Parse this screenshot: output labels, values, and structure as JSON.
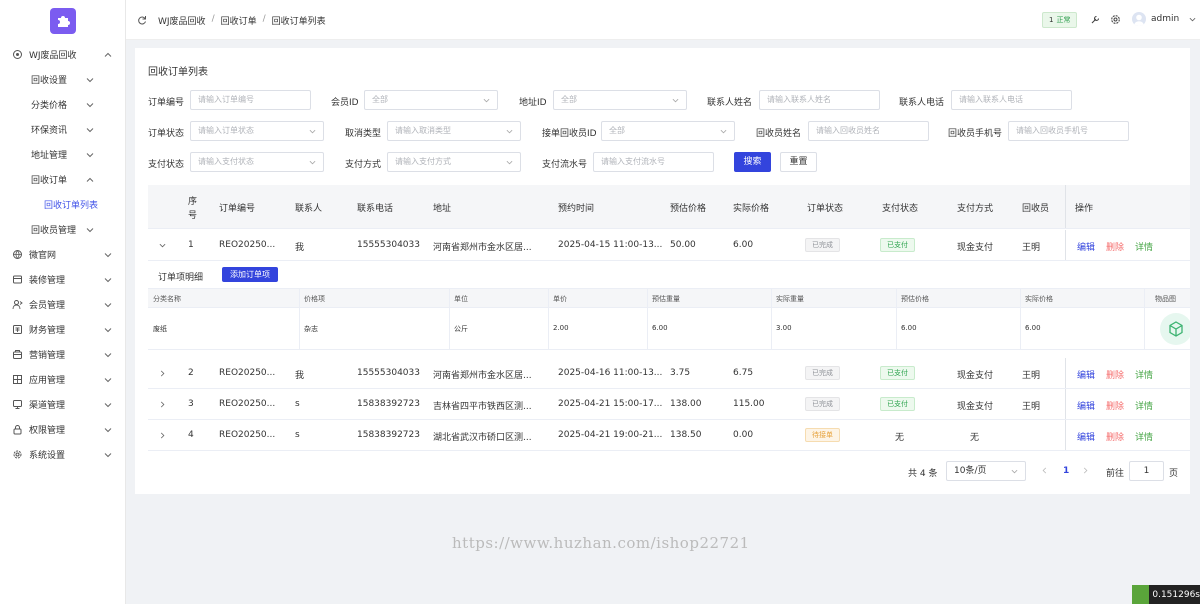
{
  "sidebar": {
    "items": [
      {
        "label": "WJ废品回收",
        "icon": "puzzle-icon",
        "arrow": "up"
      },
      {
        "label": "回收设置",
        "arrow": "down"
      },
      {
        "label": "分类价格",
        "arrow": "down"
      },
      {
        "label": "环保资讯",
        "arrow": "down"
      },
      {
        "label": "地址管理",
        "arrow": "down"
      },
      {
        "label": "回收订单",
        "arrow": "up"
      },
      {
        "label": "回收订单列表",
        "active": true
      },
      {
        "label": "回收员管理",
        "arrow": "down"
      },
      {
        "label": "微官网",
        "icon": "globe-icon",
        "arrow": "down"
      },
      {
        "label": "装修管理",
        "icon": "decoration-icon",
        "arrow": "down"
      },
      {
        "label": "会员管理",
        "icon": "user-icon",
        "arrow": "down"
      },
      {
        "label": "财务管理",
        "icon": "finance-icon",
        "arrow": "down"
      },
      {
        "label": "营销管理",
        "icon": "marketing-icon",
        "arrow": "down"
      },
      {
        "label": "应用管理",
        "icon": "app-icon",
        "arrow": "down"
      },
      {
        "label": "渠道管理",
        "icon": "channel-icon",
        "arrow": "down"
      },
      {
        "label": "权限管理",
        "icon": "lock-icon",
        "arrow": "down"
      },
      {
        "label": "系统设置",
        "icon": "gear-icon",
        "arrow": "down"
      }
    ]
  },
  "header": {
    "breadcrumb": [
      "WJ废品回收",
      "回收订单",
      "回收订单列表"
    ],
    "badge_count": "1",
    "badge_text": "正常",
    "username": "admin"
  },
  "card": {
    "title": "回收订单列表"
  },
  "filters": {
    "order_no": {
      "label": "订单编号",
      "placeholder": "请输入订单编号"
    },
    "member_id": {
      "label": "会员ID",
      "placeholder": "全部"
    },
    "address_id": {
      "label": "地址ID",
      "placeholder": "全部"
    },
    "contact_name": {
      "label": "联系人姓名",
      "placeholder": "请输入联系人姓名"
    },
    "contact_phone": {
      "label": "联系人电话",
      "placeholder": "请输入联系人电话"
    },
    "order_status": {
      "label": "订单状态",
      "placeholder": "请输入订单状态"
    },
    "cancel_type": {
      "label": "取消类型",
      "placeholder": "请输入取消类型"
    },
    "collector_id": {
      "label": "接单回收员ID",
      "placeholder": "全部"
    },
    "collector_name": {
      "label": "回收员姓名",
      "placeholder": "请输入回收员姓名"
    },
    "collector_phone": {
      "label": "回收员手机号",
      "placeholder": "请输入回收员手机号"
    },
    "pay_status": {
      "label": "支付状态",
      "placeholder": "请输入支付状态"
    },
    "pay_method": {
      "label": "支付方式",
      "placeholder": "请输入支付方式"
    },
    "pay_serial": {
      "label": "支付流水号",
      "placeholder": "请输入支付流水号"
    },
    "search_label": "搜索",
    "reset_label": "重置"
  },
  "table": {
    "headers": {
      "seq_1": "序",
      "seq_2": "号",
      "order_no": "订单编号",
      "contact": "联系人",
      "phone": "联系电话",
      "address": "地址",
      "appoint_time": "预约时间",
      "est_price": "预估价格",
      "real_price": "实际价格",
      "order_status": "订单状态",
      "pay_status": "支付状态",
      "pay_method": "支付方式",
      "collector": "回收员",
      "ops": "操作"
    },
    "rows": [
      {
        "seq": "1",
        "order_no": "REO20250...",
        "contact": "我",
        "phone": "15555304033",
        "address": "河南省郑州市金水区居...",
        "appoint_time": "2025-04-15 11:00-13...",
        "est_price": "50.00",
        "real_price": "6.00",
        "order_status": "已完成",
        "pay_status": "已支付",
        "pay_method": "现金支付",
        "collector": "王明"
      },
      {
        "seq": "2",
        "order_no": "REO20250...",
        "contact": "我",
        "phone": "15555304033",
        "address": "河南省郑州市金水区居...",
        "appoint_time": "2025-04-16 11:00-13...",
        "est_price": "3.75",
        "real_price": "6.75",
        "order_status": "已完成",
        "pay_status": "已支付",
        "pay_method": "现金支付",
        "collector": "王明"
      },
      {
        "seq": "3",
        "order_no": "REO20250...",
        "contact": "s",
        "phone": "15838392723",
        "address": "吉林省四平市铁西区测...",
        "appoint_time": "2025-04-21 15:00-17...",
        "est_price": "138.00",
        "real_price": "115.00",
        "order_status": "已完成",
        "pay_status": "已支付",
        "pay_method": "现金支付",
        "collector": "王明"
      },
      {
        "seq": "4",
        "order_no": "REO20250...",
        "contact": "s",
        "phone": "15838392723",
        "address": "湖北省武汉市硚口区测...",
        "appoint_time": "2025-04-21 19:00-21...",
        "est_price": "138.50",
        "real_price": "0.00",
        "order_status": "待接单",
        "pay_status": "无",
        "pay_method": "无",
        "collector": ""
      }
    ],
    "actions": {
      "edit": "编辑",
      "delete": "删除",
      "detail": "详情"
    }
  },
  "detail": {
    "title": "订单项明细",
    "add_label": "添加订单项",
    "headers": [
      "分类名称",
      "价格项",
      "单位",
      "单价",
      "预估重量",
      "实际重量",
      "预估价格",
      "实际价格",
      "物品图"
    ],
    "row": [
      "废纸",
      "杂志",
      "公斤",
      "2.00",
      "6.00",
      "3.00",
      "6.00",
      "6.00"
    ]
  },
  "pagination": {
    "total": "共 4 条",
    "page_size": "10条/页",
    "current": "1",
    "goto_label": "前往",
    "goto_value": "1",
    "page_suffix": "页"
  },
  "watermark": "https://www.huzhan.com/ishop22721",
  "timer": "0.151296s"
}
